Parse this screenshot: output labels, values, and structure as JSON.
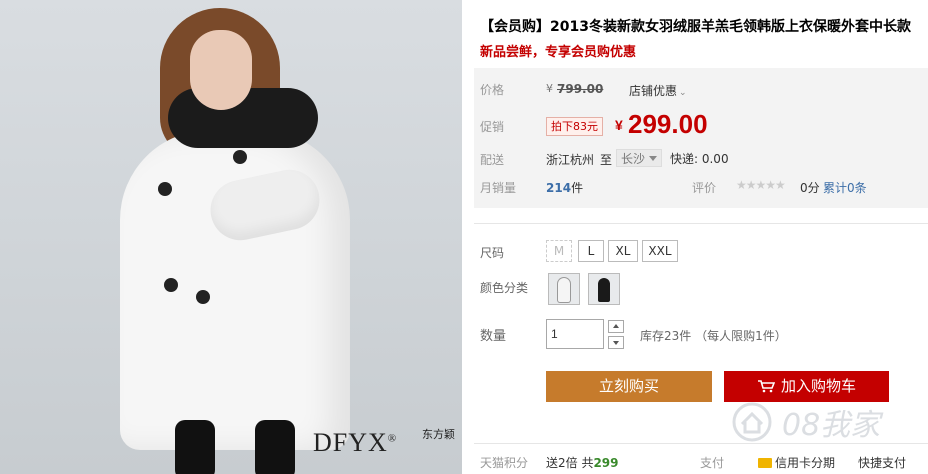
{
  "image": {
    "brand_logo": "DFYX",
    "brand_reg": "®",
    "brand_cn": "东方颖"
  },
  "product": {
    "title": "【会员购】2013冬装新款女羽绒服羊羔毛领韩版上衣保暖外套中长款",
    "subtitle": "新品尝鲜，专享会员购优惠"
  },
  "price": {
    "label": "价格",
    "currency": "¥",
    "original": "799.00",
    "store_promo": "店铺优惠"
  },
  "promo": {
    "label": "促销",
    "discount_tag": "拍下83元",
    "currency": "¥",
    "price": "299.00"
  },
  "shipping": {
    "label": "配送",
    "from": "浙江杭州",
    "to_word": "至",
    "destination": "长沙",
    "express": "快递: 0.00"
  },
  "sales": {
    "label": "月销量",
    "count": "214",
    "unit": "件",
    "rating_label": "评价",
    "stars": "★★★★★",
    "score": "0分",
    "reviews": "累计0条"
  },
  "size": {
    "label": "尺码",
    "options": [
      "M",
      "L",
      "XL",
      "XXL"
    ]
  },
  "color": {
    "label": "颜色分类",
    "options": [
      "white-coat",
      "black-coat"
    ]
  },
  "quantity": {
    "label": "数量",
    "value": "1",
    "stock": "库存23件  （每人限购1件）"
  },
  "actions": {
    "buy_now": "立刻购买",
    "add_cart": "加入购物车"
  },
  "footer": {
    "points_label": "天猫积分",
    "points_text": "送2倍 共",
    "points_value": "299",
    "pay_label": "支付",
    "credit": "信用卡分期",
    "quick_pay": "快捷支付"
  },
  "watermark": {
    "text": "08我家"
  },
  "colors": {
    "accent_red": "#c40000",
    "buy_orange": "#c67b2c",
    "link_blue": "#3c6ea8"
  }
}
